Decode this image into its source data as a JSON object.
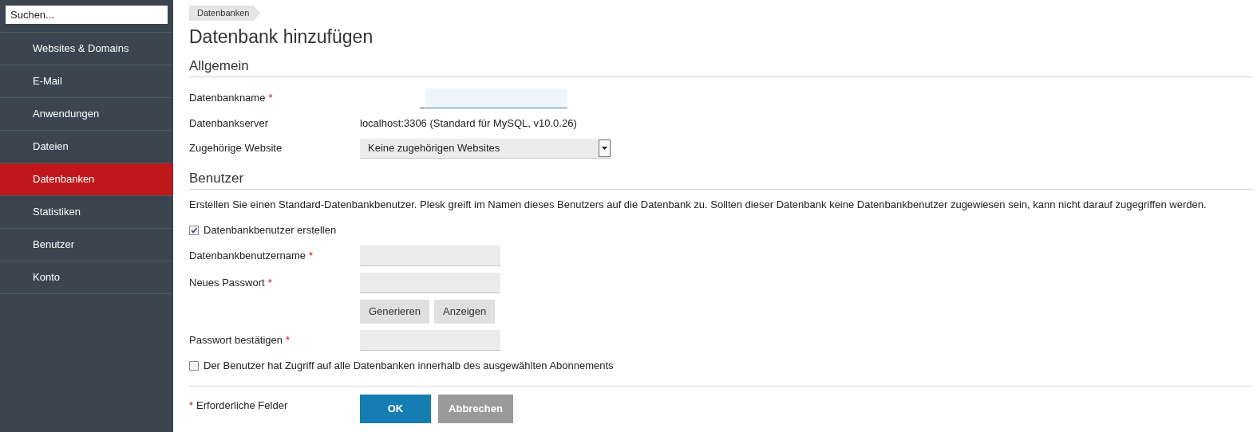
{
  "sidebar": {
    "search": {
      "placeholder": "Suchen..."
    },
    "items": [
      {
        "label": "Websites & Domains",
        "selected": false
      },
      {
        "label": "E-Mail",
        "selected": false
      },
      {
        "label": "Anwendungen",
        "selected": false
      },
      {
        "label": "Dateien",
        "selected": false
      },
      {
        "label": "Datenbanken",
        "selected": true
      },
      {
        "label": "Statistiken",
        "selected": false
      },
      {
        "label": "Benutzer",
        "selected": false
      },
      {
        "label": "Konto",
        "selected": false
      }
    ]
  },
  "breadcrumb": "Datenbanken",
  "title": "Datenbank hinzufügen",
  "sections": [
    {
      "heading": "Allgemein",
      "rows": [
        {
          "kind": "prefixed_input",
          "label": "Datenbankname",
          "required_mark": "*",
          "prefix": "_"
        },
        {
          "kind": "text",
          "label": "Datenbankserver",
          "value": "localhost:3306 (Standard für MySQL, v10.0.26)"
        },
        {
          "kind": "select",
          "label": "Zugehörige Website",
          "value": "Keine zugehörigen Websites"
        }
      ]
    },
    {
      "heading": "Benutzer",
      "description": "Erstellen Sie einen Standard-Datenbankbenutzer. Plesk greift im Namen dieses Benutzers auf die Datenbank zu. Sollten dieser Datenbank keine Datenbankbenutzer zugewiesen sein, kann nicht darauf zugegriffen werden.",
      "rows": [
        {
          "kind": "checkbox",
          "label": "Datenbankbenutzer erstellen",
          "checked": true
        },
        {
          "kind": "input",
          "label": "Datenbankbenutzername",
          "required_mark": "*"
        },
        {
          "kind": "input",
          "label": "Neues Passwort",
          "required_mark": "*"
        },
        {
          "kind": "buttons",
          "buttons": [
            "Generieren",
            "Anzeigen"
          ]
        },
        {
          "kind": "input",
          "label": "Passwort bestätigen",
          "required_mark": "*"
        },
        {
          "kind": "checkbox",
          "label": "Der Benutzer hat Zugriff auf alle Datenbanken innerhalb des ausgewählten Abonnements",
          "checked": false
        }
      ]
    }
  ],
  "footer": {
    "required_note": {
      "mark": "*",
      "text": "Erforderliche Felder"
    },
    "ok": "OK",
    "cancel": "Abbrechen"
  }
}
